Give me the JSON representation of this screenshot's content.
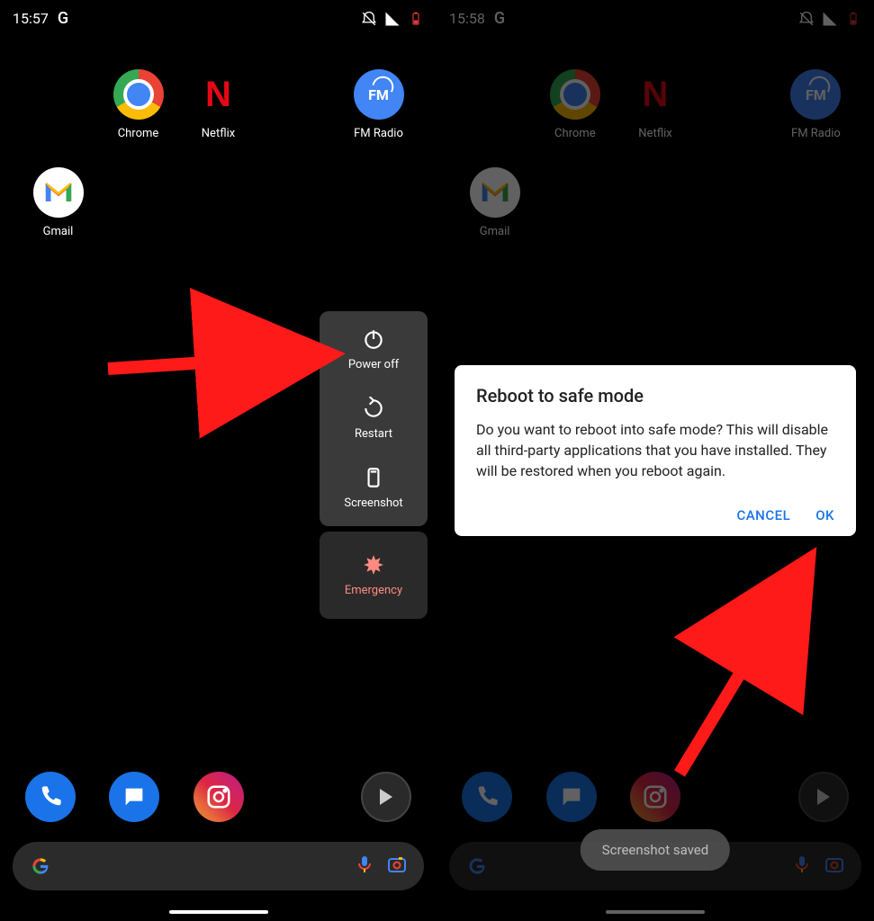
{
  "left": {
    "status": {
      "time": "15:57",
      "indicator": "G"
    },
    "apps": {
      "chrome": "Chrome",
      "netflix": "Netflix",
      "fmradio": "FM Radio",
      "gmail": "Gmail"
    },
    "power_menu": {
      "power_off": "Power off",
      "restart": "Restart",
      "screenshot": "Screenshot",
      "emergency": "Emergency"
    }
  },
  "right": {
    "status": {
      "time": "15:58",
      "indicator": "G"
    },
    "apps": {
      "chrome": "Chrome",
      "netflix": "Netflix",
      "fmradio": "FM Radio",
      "gmail": "Gmail"
    },
    "dialog": {
      "title": "Reboot to safe mode",
      "body": "Do you want to reboot into safe mode? This will disable all third-party applications that you have installed. They will be restored when you reboot again.",
      "cancel": "CANCEL",
      "ok": "OK"
    },
    "toast": "Screenshot saved"
  }
}
